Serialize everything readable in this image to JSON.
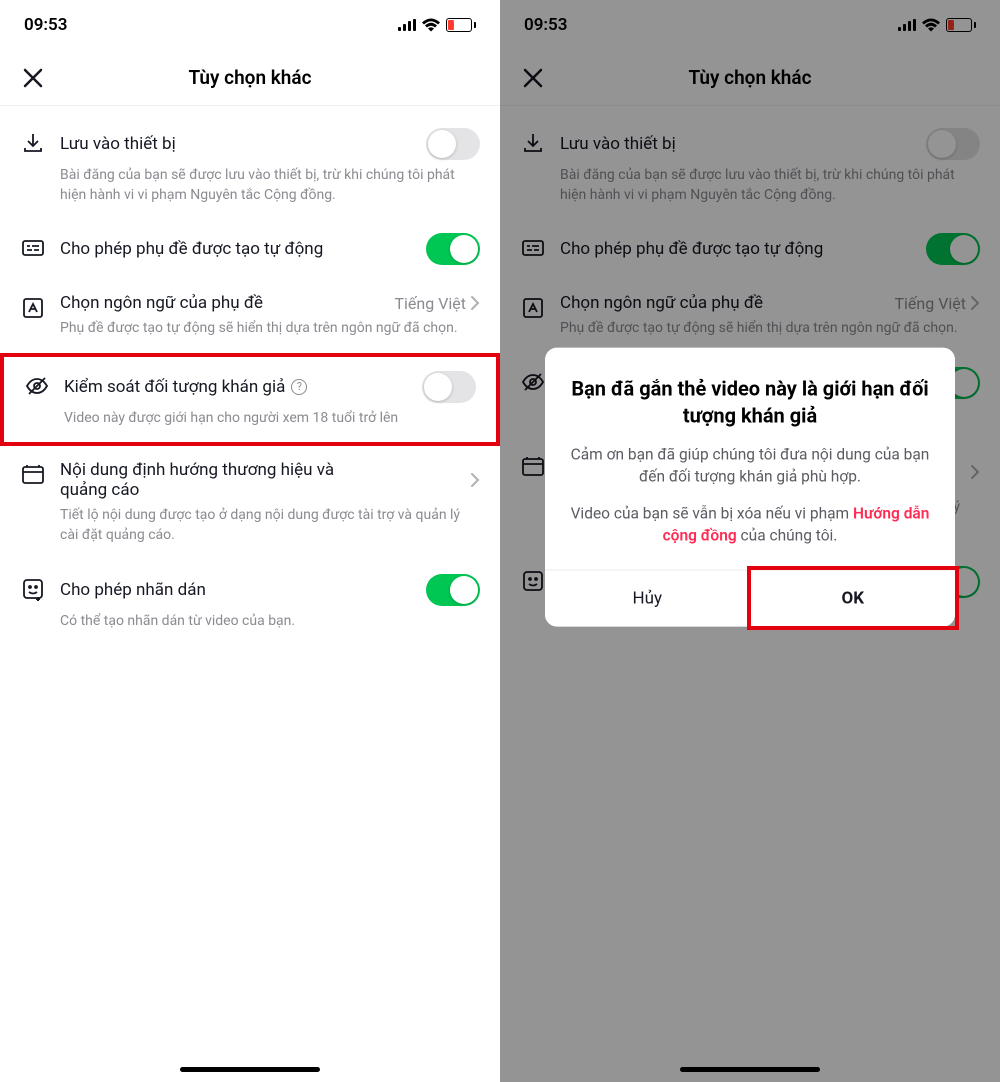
{
  "status": {
    "time": "09:53",
    "battery_pct": "20"
  },
  "header": {
    "title": "Tùy chọn khác"
  },
  "settings": {
    "save": {
      "title": "Lưu vào thiết bị",
      "desc": "Bài đăng của bạn sẽ được lưu vào thiết bị, trừ khi chúng tôi phát hiện hành vi vi phạm Nguyên tắc Cộng đồng."
    },
    "captions": {
      "title": "Cho phép phụ đề được tạo tự động"
    },
    "language": {
      "title": "Chọn ngôn ngữ của phụ đề",
      "value": "Tiếng Việt",
      "desc": "Phụ đề được tạo tự động sẽ hiển thị dựa trên ngôn ngữ đã chọn."
    },
    "audience": {
      "title": "Kiểm soát đối tượng khán giả",
      "desc": "Video này được giới hạn cho người xem 18 tuổi trở lên"
    },
    "branded": {
      "title": "Nội dung định hướng thương hiệu và quảng cáo",
      "desc": "Tiết lộ nội dung được tạo ở dạng nội dung được tài trợ và quản lý cài đặt quảng cáo."
    },
    "stickers": {
      "title": "Cho phép nhãn dán",
      "desc": "Có thể tạo nhãn dán từ video của bạn."
    }
  },
  "dialog": {
    "title": "Bạn đã gắn thẻ video này là giới hạn đối tượng khán giả",
    "text1": "Cảm ơn bạn đã giúp chúng tôi đưa nội dung của bạn đến đối tượng khán giả phù hợp.",
    "text2_pre": "Video của bạn sẽ vẫn bị xóa nếu vi phạm ",
    "text2_link": "Hướng dẫn cộng đồng",
    "text2_post": " của chúng tôi.",
    "cancel": "Hủy",
    "ok": "OK"
  }
}
